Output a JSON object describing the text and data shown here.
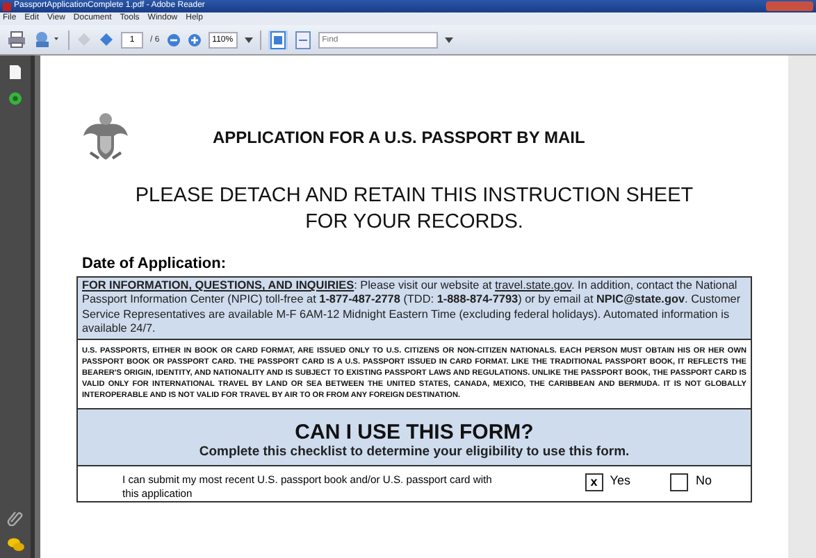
{
  "window": {
    "title": "PassportApplicationComplete 1.pdf - Adobe Reader"
  },
  "menu": [
    "File",
    "Edit",
    "View",
    "Document",
    "Tools",
    "Window",
    "Help"
  ],
  "toolbar": {
    "page": "1",
    "page_count": "/ 6",
    "zoom": "110%",
    "find": {
      "placeholder": "Find"
    }
  },
  "document": {
    "title": "APPLICATION FOR A U.S. PASSPORT BY MAIL",
    "subtitle_lines": [
      "PLEASE DETACH AND RETAIN THIS INSTRUCTION SHEET",
      "FOR YOUR RECORDS."
    ],
    "date_label": "Date of Application:",
    "info": [
      {
        "kind": "heading",
        "text": "FOR INFORMATION, QUESTIONS, AND INQUIRIES"
      },
      {
        "kind": "text",
        "text": ": Please visit our website at "
      },
      {
        "kind": "link",
        "text": "travel.state.gov"
      },
      {
        "kind": "text",
        "text": ". In addition, contact the National Passport Information Center (NPIC) toll-free at "
      },
      {
        "kind": "bold",
        "text": "1-877-487-2778"
      },
      {
        "kind": "text",
        "text": " (TDD: "
      },
      {
        "kind": "bold",
        "text": "1-888-874-7793"
      },
      {
        "kind": "text",
        "text": ") or by email at "
      },
      {
        "kind": "bold",
        "text": "NPIC@state.gov"
      },
      {
        "kind": "text",
        "text": ".  Customer Service Representatives are available M-F 6AM-12 Midnight Eastern Time (excluding federal holidays).  Automated information is available 24/7."
      }
    ],
    "notice": "U.S. PASSPORTS, EITHER IN BOOK OR CARD FORMAT, ARE ISSUED ONLY TO U.S. CITIZENS OR NON-CITIZEN NATIONALS. EACH PERSON MUST OBTAIN HIS OR HER OWN PASSPORT BOOK OR PASSPORT CARD. THE PASSPORT CARD IS A U.S. PASSPORT ISSUED IN CARD FORMAT. LIKE THE TRADITIONAL PASSPORT BOOK, IT REFLECTS THE BEARER'S ORIGIN, IDENTITY, AND NATIONALITY AND IS SUBJECT TO EXISTING PASSPORT LAWS AND REGULATIONS. UNLIKE THE PASSPORT BOOK, THE PASSPORT CARD IS VALID ONLY FOR INTERNATIONAL TRAVEL BY LAND OR SEA BETWEEN THE UNITED STATES, CANADA, MEXICO, THE CARIBBEAN AND BERMUDA. IT IS NOT GLOBALLY INTEROPERABLE AND IS NOT VALID FOR TRAVEL BY AIR TO OR FROM ANY FOREIGN DESTINATION.",
    "section": {
      "title": "CAN I USE THIS FORM?",
      "subtitle": "Complete this checklist to determine your eligibility to use this form."
    },
    "checklist": {
      "check_char": "x",
      "items": [
        {
          "text": "I can submit my most recent U.S. passport book and/or U.S. passport card with this application",
          "options": [
            {
              "label": "Yes",
              "checked": true
            },
            {
              "label": "No",
              "checked": false
            }
          ]
        }
      ]
    }
  }
}
